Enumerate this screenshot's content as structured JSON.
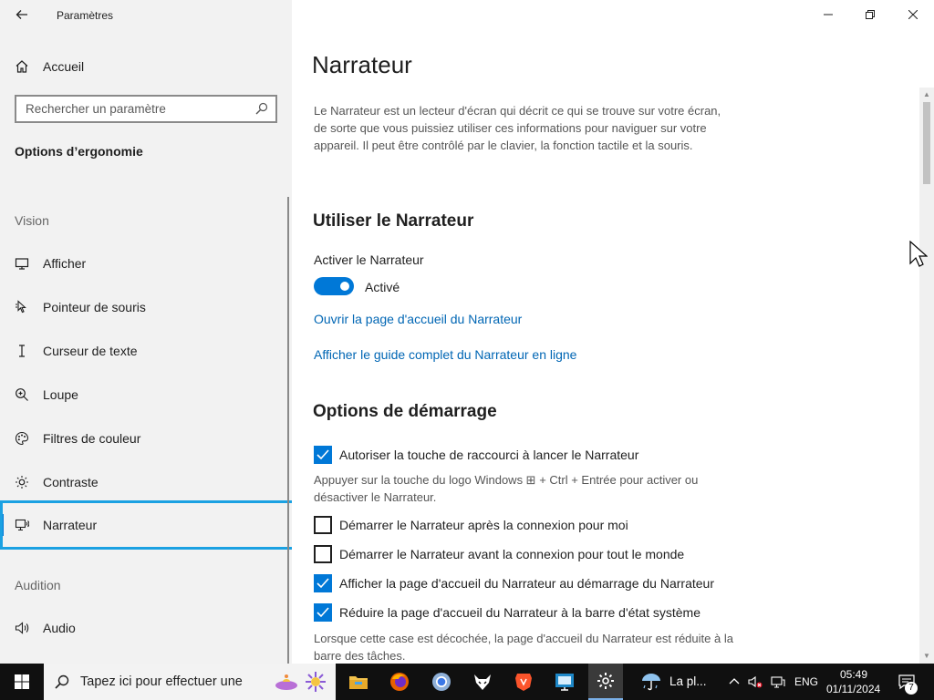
{
  "app": {
    "title": "Paramètres",
    "back_icon": "arrow-left-icon"
  },
  "sidebar": {
    "home_label": "Accueil",
    "search_placeholder": "Rechercher un paramètre",
    "section_title": "Options d’ergonomie",
    "groups": {
      "vision": "Vision",
      "audition": "Audition"
    },
    "items": [
      {
        "label": "Afficher",
        "icon": "monitor-icon"
      },
      {
        "label": "Pointeur de souris",
        "icon": "mouse-pointer-icon"
      },
      {
        "label": "Curseur de texte",
        "icon": "text-cursor-icon"
      },
      {
        "label": "Loupe",
        "icon": "magnifier-icon"
      },
      {
        "label": "Filtres de couleur",
        "icon": "color-filter-icon"
      },
      {
        "label": "Contraste",
        "icon": "contrast-icon"
      },
      {
        "label": "Narrateur",
        "icon": "narrator-icon",
        "selected": true
      },
      {
        "label": "Audio",
        "icon": "speaker-icon"
      }
    ]
  },
  "main": {
    "title": "Narrateur",
    "description": "Le Narrateur est un lecteur d'écran qui décrit ce qui se trouve sur votre écran, de sorte que vous puissiez utiliser ces informations pour naviguer sur votre appareil. Il peut être contrôlé par le clavier, la fonction tactile et la souris.",
    "use_section": {
      "heading": "Utiliser le Narrateur",
      "toggle_label": "Activer le Narrateur",
      "toggle_state": "Activé",
      "toggle_on": true,
      "link_home": "Ouvrir la page d'accueil du Narrateur",
      "link_guide": "Afficher le guide complet du Narrateur en ligne"
    },
    "startup_section": {
      "heading": "Options de démarrage",
      "options": [
        {
          "label": "Autoriser la touche de raccourci à lancer le Narrateur",
          "checked": true
        },
        {
          "label": "Démarrer le Narrateur après la connexion pour moi",
          "checked": false
        },
        {
          "label": "Démarrer le Narrateur avant la connexion pour tout le monde",
          "checked": false
        },
        {
          "label": "Afficher la page d'accueil du Narrateur au démarrage du Narrateur",
          "checked": true
        },
        {
          "label": "Réduire la page d'accueil du Narrateur à la barre d'état système",
          "checked": true
        }
      ],
      "shortcut_hint": "Appuyer sur la touche du logo Windows ⊞ + Ctrl + Entrée pour activer ou désactiver le Narrateur.",
      "minimize_hint": "Lorsque cette case est décochée, la page d'accueil du Narrateur est réduite à la barre des tâches."
    }
  },
  "window_controls": {
    "minimize": "minimize-icon",
    "maximize": "restore-icon",
    "close": "close-icon"
  },
  "taskbar": {
    "search_placeholder": "Tapez ici pour effectuer une",
    "weather": "La pl...",
    "language": "ENG",
    "time": "05:49",
    "date": "01/11/2024",
    "notifications_count": "7",
    "apps": [
      "file-explorer-icon",
      "firefox-icon",
      "chrome-icon",
      "wolf-app-icon",
      "brave-icon",
      "remote-desktop-icon",
      "settings-icon"
    ]
  }
}
